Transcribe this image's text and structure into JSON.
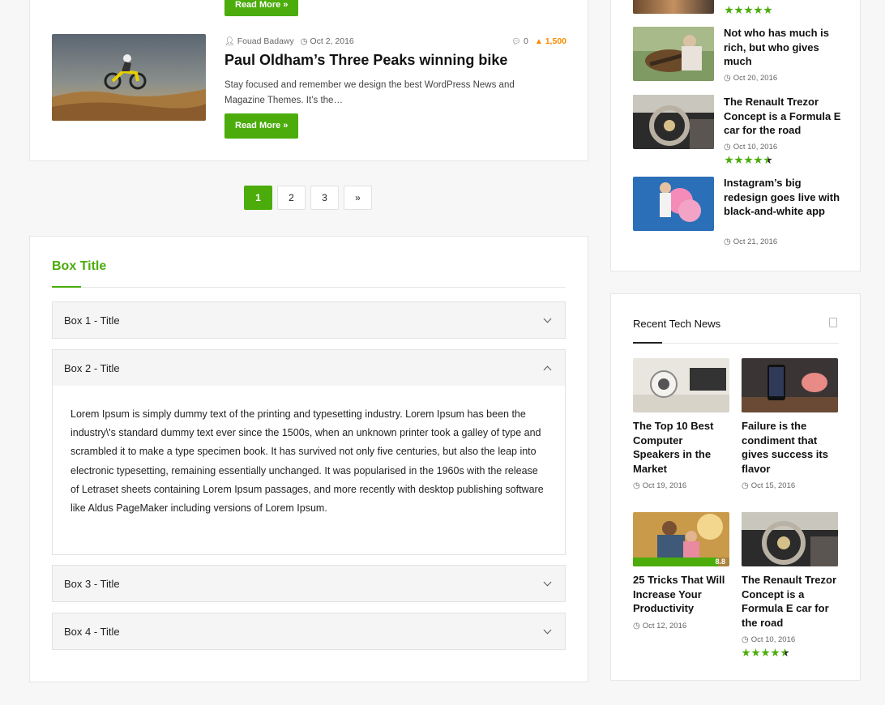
{
  "top_post": {
    "read_more": "Read More »"
  },
  "post": {
    "author": "Fouad Badawy",
    "date": "Oct 2, 2016",
    "comments": "0",
    "views": "1,500",
    "title": "Paul Oldham’s Three Peaks winning bike",
    "excerpt": "Stay focused and remember we design the best WordPress News and Magazine Themes. It’s the…",
    "read_more": "Read More »"
  },
  "pagination": {
    "pages": [
      "1",
      "2",
      "3"
    ],
    "next": "»",
    "current": "1"
  },
  "box": {
    "title": "Box Title",
    "items": [
      {
        "title": "Box 1 - Title"
      },
      {
        "title": "Box 2 - Title",
        "body": "Lorem Ipsum is simply dummy text of the printing and typesetting industry. Lorem Ipsum has been the industry\\'s standard dummy text ever since the 1500s, when an unknown printer took a galley of type and scrambled it to make a type specimen book. It has survived not only five centuries, but also the leap into electronic typesetting, remaining essentially unchanged. It was popularised in the 1960s with the release of Letraset sheets containing Lorem Ipsum passages, and more recently with desktop publishing software like Aldus PageMaker including versions of Lorem Ipsum."
      },
      {
        "title": "Box 3 - Title"
      },
      {
        "title": "Box 4 - Title"
      }
    ]
  },
  "sidebar_posts": [
    {
      "title": "Not who has much is rich, but who gives much",
      "date": "Oct 20, 2016"
    },
    {
      "title": "The Renault Trezor Concept is a Formula E car for the road",
      "date": "Oct 10, 2016",
      "rating": 4.5
    },
    {
      "title": "Instagram’s big redesign goes live with black-and-white app",
      "date": "Oct 21, 2016"
    }
  ],
  "top_rating": 5,
  "recent_tech": {
    "title": "Recent Tech News",
    "items": [
      {
        "title": "The Top 10 Best Computer Speakers in the Market",
        "date": "Oct 19, 2016"
      },
      {
        "title": "Failure is the condiment that gives success its flavor",
        "date": "Oct 15, 2016"
      },
      {
        "title": "25 Tricks That Will Increase Your Productivity",
        "date": "Oct 12, 2016",
        "score": "8.8",
        "score_fraction": 0.88
      },
      {
        "title": "The Renault Trezor Concept is a Formula E car for the road",
        "date": "Oct 10, 2016",
        "rating": 4.5
      }
    ]
  },
  "colors": {
    "accent": "#4bac0b",
    "views": "#f88c00"
  },
  "icons": {
    "author": "user-icon",
    "date": "clock-icon",
    "comments": "comment-icon",
    "views": "fire-icon",
    "widget": "document-icon"
  }
}
